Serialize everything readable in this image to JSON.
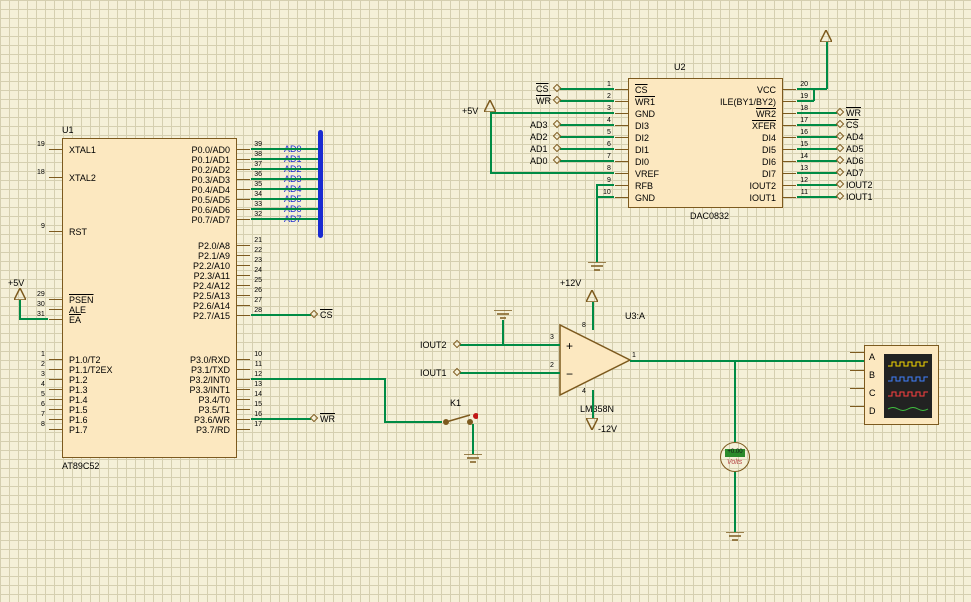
{
  "components": {
    "u1": {
      "ref": "U1",
      "part": "AT89C52",
      "left_pins": [
        {
          "num": "19",
          "name": "XTAL1"
        },
        {
          "num": "18",
          "name": "XTAL2"
        },
        {
          "num": "9",
          "name": "RST"
        },
        {
          "num": "29",
          "name": "PSEN",
          "over": true
        },
        {
          "num": "30",
          "name": "ALE"
        },
        {
          "num": "31",
          "name": "EA",
          "over": true
        },
        {
          "num": "1",
          "name": "P1.0/T2"
        },
        {
          "num": "2",
          "name": "P1.1/T2EX"
        },
        {
          "num": "3",
          "name": "P1.2"
        },
        {
          "num": "4",
          "name": "P1.3"
        },
        {
          "num": "5",
          "name": "P1.4"
        },
        {
          "num": "6",
          "name": "P1.5"
        },
        {
          "num": "7",
          "name": "P1.6"
        },
        {
          "num": "8",
          "name": "P1.7"
        }
      ],
      "right_top": [
        {
          "num": "39",
          "name": "P0.0/AD0",
          "net": "AD0"
        },
        {
          "num": "38",
          "name": "P0.1/AD1",
          "net": "AD1"
        },
        {
          "num": "37",
          "name": "P0.2/AD2",
          "net": "AD2"
        },
        {
          "num": "36",
          "name": "P0.3/AD3",
          "net": "AD3"
        },
        {
          "num": "35",
          "name": "P0.4/AD4",
          "net": "AD4"
        },
        {
          "num": "34",
          "name": "P0.5/AD5",
          "net": "AD5"
        },
        {
          "num": "33",
          "name": "P0.6/AD6",
          "net": "AD6"
        },
        {
          "num": "32",
          "name": "P0.7/AD7",
          "net": "AD7"
        }
      ],
      "right_mid": [
        {
          "num": "21",
          "name": "P2.0/A8"
        },
        {
          "num": "22",
          "name": "P2.1/A9"
        },
        {
          "num": "23",
          "name": "P2.2/A10"
        },
        {
          "num": "24",
          "name": "P2.3/A11"
        },
        {
          "num": "25",
          "name": "P2.4/A12"
        },
        {
          "num": "26",
          "name": "P2.5/A13"
        },
        {
          "num": "27",
          "name": "P2.6/A14"
        },
        {
          "num": "28",
          "name": "P2.7/A15",
          "net": "CS",
          "over": true
        }
      ],
      "right_bot": [
        {
          "num": "10",
          "name": "P3.0/RXD"
        },
        {
          "num": "11",
          "name": "P3.1/TXD"
        },
        {
          "num": "12",
          "name": "P3.2/INT0",
          "over": true
        },
        {
          "num": "13",
          "name": "P3.3/INT1",
          "over": true
        },
        {
          "num": "14",
          "name": "P3.4/T0"
        },
        {
          "num": "15",
          "name": "P3.5/T1"
        },
        {
          "num": "16",
          "name": "P3.6/WR",
          "over": true,
          "net": "WR",
          "netover": true
        },
        {
          "num": "17",
          "name": "P3.7/RD",
          "over": true
        }
      ]
    },
    "u2": {
      "ref": "U2",
      "part": "DAC0832",
      "left": [
        {
          "num": "1",
          "name": "CS",
          "over": true,
          "net": "CS",
          "netover": true
        },
        {
          "num": "2",
          "name": "WR1",
          "over": true,
          "net": "WR",
          "netover": true
        },
        {
          "num": "3",
          "name": "GND"
        },
        {
          "num": "4",
          "name": "DI3",
          "net": "AD3"
        },
        {
          "num": "5",
          "name": "DI2",
          "net": "AD2"
        },
        {
          "num": "6",
          "name": "DI1",
          "net": "AD1"
        },
        {
          "num": "7",
          "name": "DI0",
          "net": "AD0"
        },
        {
          "num": "8",
          "name": "VREF"
        },
        {
          "num": "9",
          "name": "RFB"
        },
        {
          "num": "10",
          "name": "GND"
        }
      ],
      "right": [
        {
          "num": "20",
          "name": "VCC"
        },
        {
          "num": "19",
          "name": "ILE(BY1/BY2)",
          "over": true
        },
        {
          "num": "18",
          "name": "WR2",
          "over": true,
          "net": "WR",
          "netover": true
        },
        {
          "num": "17",
          "name": "XFER",
          "over": true,
          "net": "CS",
          "netover": true
        },
        {
          "num": "16",
          "name": "DI4",
          "net": "AD4"
        },
        {
          "num": "15",
          "name": "DI5",
          "net": "AD5"
        },
        {
          "num": "14",
          "name": "DI6",
          "net": "AD6"
        },
        {
          "num": "13",
          "name": "DI7",
          "net": "AD7"
        },
        {
          "num": "12",
          "name": "IOUT2",
          "net": "IOUT2"
        },
        {
          "num": "11",
          "name": "IOUT1",
          "net": "IOUT1"
        }
      ]
    },
    "u3": {
      "ref": "U3:A",
      "part": "LM358N",
      "pin_plus": "3",
      "pin_minus": "2",
      "pin_out": "1",
      "pin_vp": "8",
      "pin_vm": "4"
    },
    "k1": {
      "ref": "K1"
    },
    "scope_ch": [
      "A",
      "B",
      "C",
      "D"
    ],
    "volt": {
      "label": "Volts",
      "reading": "+0.00"
    }
  },
  "power": {
    "p5v": "+5V",
    "p12v": "+12V",
    "m12v": "-12V"
  }
}
